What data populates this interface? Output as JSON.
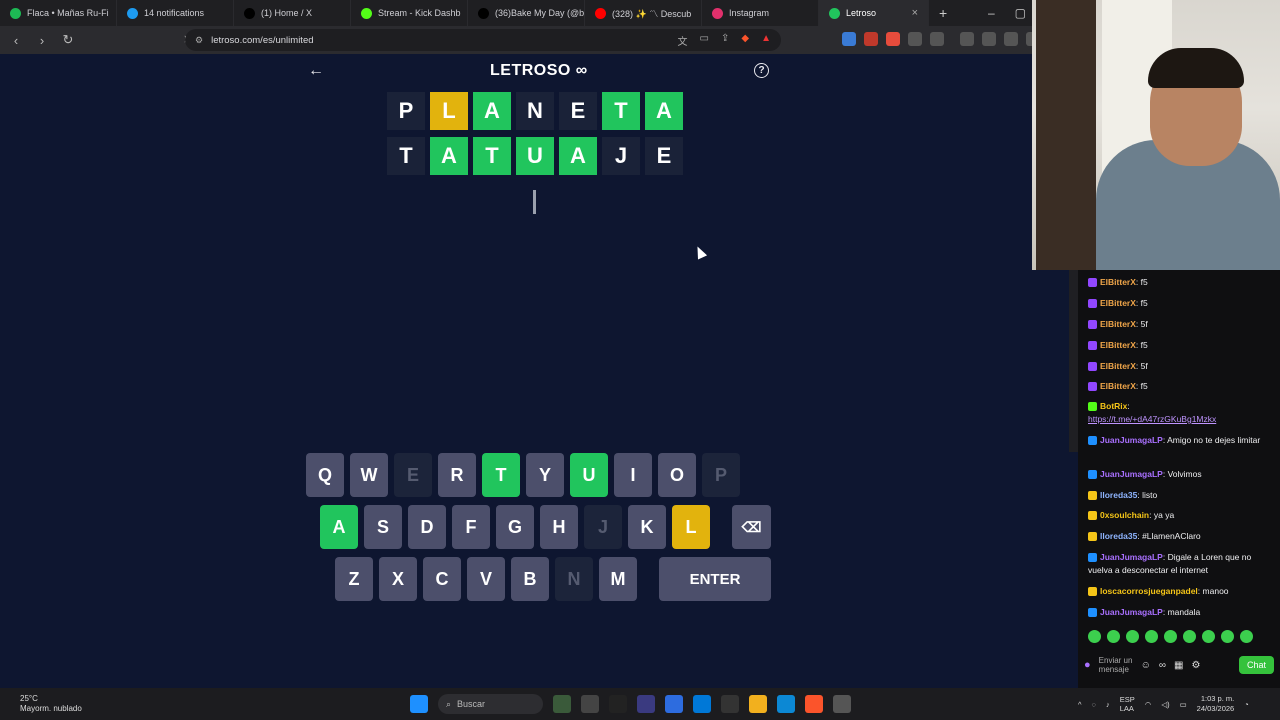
{
  "browser": {
    "tabs": [
      {
        "label": "Flaca • Mañas Ru-Fi",
        "color": "#1db954"
      },
      {
        "label": "14 notifications",
        "color": "#1d9bf0"
      },
      {
        "label": "(1) Home / X",
        "color": "#000000"
      },
      {
        "label": "Stream - Kick Dashb",
        "color": "#53fc18"
      },
      {
        "label": "(36)Bake My Day (@ba",
        "color": "#000000"
      },
      {
        "label": "(328) ✨ 〽 Descub",
        "color": "#ff0000"
      },
      {
        "label": "Instagram",
        "color": "#e1306c"
      },
      {
        "label": "Letroso",
        "color": "#21c55d",
        "active": true
      }
    ],
    "new_tab": "+",
    "url": "letroso.com/es/unlimited"
  },
  "game": {
    "logo": "LETROSO ∞",
    "back": "←",
    "help": "?",
    "rows": [
      [
        {
          "l": "P",
          "s": "empty"
        },
        {
          "l": "L",
          "s": "yellow"
        },
        {
          "l": "A",
          "s": "green"
        },
        {
          "l": "N",
          "s": "empty"
        },
        {
          "l": "E",
          "s": "empty"
        },
        {
          "l": "T",
          "s": "green"
        },
        {
          "l": "A",
          "s": "green"
        }
      ],
      [
        {
          "l": "T",
          "s": "empty"
        },
        {
          "l": "A",
          "s": "green"
        },
        {
          "l": "T",
          "s": "green"
        },
        {
          "l": "U",
          "s": "green"
        },
        {
          "l": "A",
          "s": "green"
        },
        {
          "l": "J",
          "s": "empty"
        },
        {
          "l": "E",
          "s": "empty"
        }
      ]
    ],
    "keyboard": [
      [
        {
          "k": "Q",
          "s": "normal"
        },
        {
          "k": "W",
          "s": "normal"
        },
        {
          "k": "E",
          "s": "absent"
        },
        {
          "k": "R",
          "s": "normal"
        },
        {
          "k": "T",
          "s": "green"
        },
        {
          "k": "Y",
          "s": "normal"
        },
        {
          "k": "U",
          "s": "green"
        },
        {
          "k": "I",
          "s": "normal"
        },
        {
          "k": "O",
          "s": "normal"
        },
        {
          "k": "P",
          "s": "absent"
        }
      ],
      [
        {
          "k": "A",
          "s": "green"
        },
        {
          "k": "S",
          "s": "normal"
        },
        {
          "k": "D",
          "s": "normal"
        },
        {
          "k": "F",
          "s": "normal"
        },
        {
          "k": "G",
          "s": "normal"
        },
        {
          "k": "H",
          "s": "normal"
        },
        {
          "k": "J",
          "s": "absent"
        },
        {
          "k": "K",
          "s": "normal"
        },
        {
          "k": "L",
          "s": "yellow"
        },
        {
          "k": "⌫",
          "s": "back"
        }
      ],
      [
        {
          "k": "Z",
          "s": "normal"
        },
        {
          "k": "X",
          "s": "normal"
        },
        {
          "k": "C",
          "s": "normal"
        },
        {
          "k": "V",
          "s": "normal"
        },
        {
          "k": "B",
          "s": "normal"
        },
        {
          "k": "N",
          "s": "absent"
        },
        {
          "k": "M",
          "s": "normal"
        },
        {
          "k": "ENTER",
          "s": "wide"
        }
      ]
    ]
  },
  "chat": {
    "messages": [
      {
        "user": "ElBitterX",
        "text": "f5",
        "color": "#f0a64a",
        "badge": "#9147ff"
      },
      {
        "user": "ElBitterX",
        "text": "f5",
        "color": "#f0a64a",
        "badge": "#9147ff"
      },
      {
        "user": "ElBitterX",
        "text": "5f",
        "color": "#f0a64a",
        "badge": "#9147ff"
      },
      {
        "user": "ElBitterX",
        "text": "f5",
        "color": "#f0a64a",
        "badge": "#9147ff"
      },
      {
        "user": "ElBitterX",
        "text": "5f",
        "color": "#f0a64a",
        "badge": "#9147ff"
      },
      {
        "user": "ElBitterX",
        "text": "f5",
        "color": "#f0a64a",
        "badge": "#9147ff"
      },
      {
        "user": "BotRix",
        "text": "",
        "color": "#f5c518",
        "badge": "#53fc18",
        "link": "https://t.me/+dA47rzGKuBg1Mzkx"
      },
      {
        "user": "JuanJumagaLP",
        "text": "Amigo no te dejes limitar",
        "color": "#a970ff",
        "badge": "#1e90ff"
      },
      {
        "user": "JuanJumagaLP",
        "text": "Volvimos",
        "color": "#a970ff",
        "badge": "#1e90ff"
      },
      {
        "user": "lloreda35",
        "text": "listo",
        "color": "#8fb5ff",
        "badge": "#f5c518"
      },
      {
        "user": "0xsoulchain",
        "text": "ya ya",
        "color": "#f5c518",
        "badge": "#f5c518"
      },
      {
        "user": "lloreda35",
        "text": "#LlamenAClaro",
        "color": "#8fb5ff",
        "badge": "#f5c518"
      },
      {
        "user": "JuanJumagaLP",
        "text": "Digale a Loren que no vuelva a desconectar el internet",
        "color": "#a970ff",
        "badge": "#1e90ff"
      },
      {
        "user": "loscacorrosjueganpadel",
        "text": "manoo",
        "color": "#f5c518",
        "badge": "#f5c518"
      },
      {
        "user": "JuanJumagaLP",
        "text": "mandala",
        "color": "#a970ff",
        "badge": "#1e90ff"
      }
    ],
    "input_placeholder": "Enviar un mensaje",
    "send_label": "Chat"
  },
  "taskbar": {
    "temp": "25°C",
    "weather": "Mayorm. nublado",
    "search": "Buscar",
    "lang": "ESP",
    "lang2": "LAA",
    "time": "1:03 p. m.",
    "date": "24/03/2026"
  }
}
